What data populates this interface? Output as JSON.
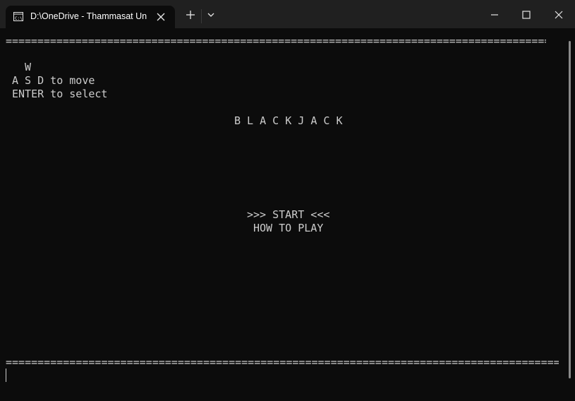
{
  "window": {
    "tab_title": "D:\\OneDrive - Thammasat Un"
  },
  "terminal": {
    "rule_top": "======================================================================================",
    "rule_bottom": "========================================================================================",
    "controls": [
      "  W",
      "A S D to move",
      "ENTER to select"
    ],
    "game_title": "B L A C K J A C K",
    "menu": {
      "start": ">>> START <<<",
      "how_to_play": "HOW TO PLAY"
    }
  },
  "colors": {
    "terminal_bg": "#0c0c0c",
    "titlebar_bg": "#202020",
    "text": "#cccccc"
  }
}
